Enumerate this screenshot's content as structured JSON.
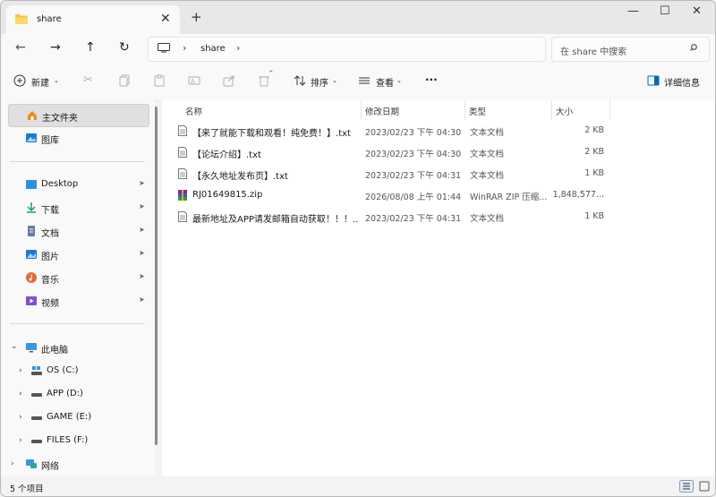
{
  "window": {
    "tab_title": "share",
    "new_tab": "+",
    "tab_close": "✕",
    "minimize": "—",
    "maximize": "☐",
    "close": "✕"
  },
  "nav": {
    "back": "←",
    "forward": "→",
    "up": "↑",
    "refresh": "↻"
  },
  "address": {
    "crumb": "share",
    "sep1": "›",
    "sep2": "›"
  },
  "search": {
    "placeholder": "在 share 中搜索"
  },
  "toolbar": {
    "new_label": "新建",
    "sort_label": "排序",
    "view_label": "查看",
    "more": "···",
    "details_label": "详细信息"
  },
  "sidebar": {
    "home": "主文件夹",
    "gallery": "图库",
    "quick": [
      {
        "label": "Desktop",
        "icon": "desktop-icon"
      },
      {
        "label": "下载",
        "icon": "download-icon"
      },
      {
        "label": "文档",
        "icon": "document-icon"
      },
      {
        "label": "图片",
        "icon": "picture-icon"
      },
      {
        "label": "音乐",
        "icon": "music-icon"
      },
      {
        "label": "视频",
        "icon": "video-icon"
      }
    ],
    "pin": "📌",
    "this_pc": "此电脑",
    "drives": [
      {
        "label": "OS (C:)"
      },
      {
        "label": "APP (D:)"
      },
      {
        "label": "GAME (E:)"
      },
      {
        "label": "FILES (F:)"
      }
    ],
    "network": "网络"
  },
  "columns": {
    "name": "名称",
    "modified": "修改日期",
    "type": "类型",
    "size": "大小"
  },
  "files": [
    {
      "name": "【来了就能下载和观看！纯免费！】.txt",
      "modified": "2023/02/23 下午 04:30",
      "type": "文本文档",
      "size": "2 KB",
      "icon": "text-file-icon"
    },
    {
      "name": "【论坛介绍】.txt",
      "modified": "2023/02/23 下午 04:30",
      "type": "文本文档",
      "size": "2 KB",
      "icon": "text-file-icon"
    },
    {
      "name": "【永久地址发布页】.txt",
      "modified": "2023/02/23 下午 04:31",
      "type": "文本文档",
      "size": "1 KB",
      "icon": "text-file-icon"
    },
    {
      "name": "RJ01649815.zip",
      "modified": "2026/08/08 上午 01:44",
      "type": "WinRAR ZIP 压缩...",
      "size": "1,848,577...",
      "icon": "winrar-zip-icon"
    },
    {
      "name": "最新地址及APP请发邮箱自动获取！！！...",
      "modified": "2023/02/23 下午 04:31",
      "type": "文本文档",
      "size": "1 KB",
      "icon": "text-file-icon"
    }
  ],
  "status": {
    "count": "5 个项目"
  },
  "colors": {
    "folder": "#f4c24f",
    "accent": "#0067c0",
    "selection": "#e0e0e0"
  }
}
